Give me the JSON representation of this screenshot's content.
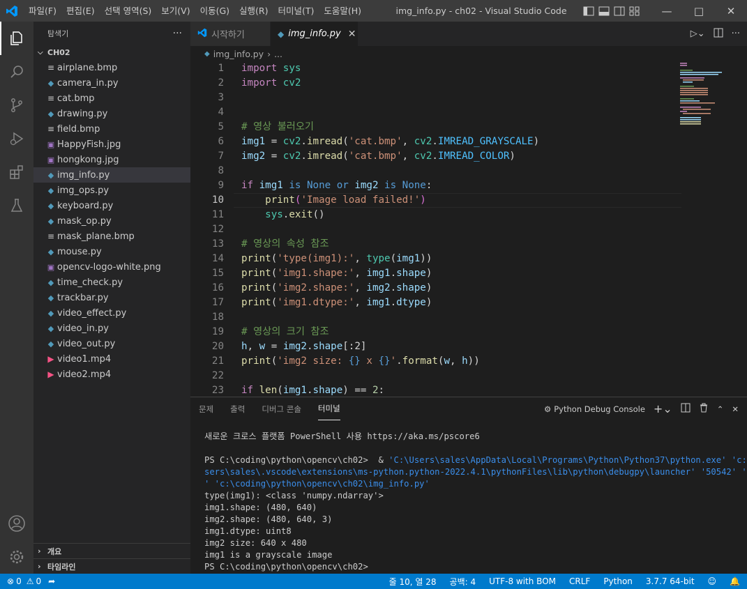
{
  "titlebar": {
    "menu": [
      "파일(F)",
      "편집(E)",
      "선택 영역(S)",
      "보기(V)",
      "이동(G)",
      "실행(R)",
      "터미널(T)",
      "도움말(H)"
    ],
    "title": "img_info.py - ch02 - Visual Studio Code"
  },
  "sidebar": {
    "header": "탐색기",
    "more": "···",
    "folder": "CH02",
    "files": [
      {
        "name": "airplane.bmp",
        "type": "bmp"
      },
      {
        "name": "camera_in.py",
        "type": "py"
      },
      {
        "name": "cat.bmp",
        "type": "bmp"
      },
      {
        "name": "drawing.py",
        "type": "py"
      },
      {
        "name": "field.bmp",
        "type": "bmp"
      },
      {
        "name": "HappyFish.jpg",
        "type": "img"
      },
      {
        "name": "hongkong.jpg",
        "type": "img"
      },
      {
        "name": "img_info.py",
        "type": "py"
      },
      {
        "name": "img_ops.py",
        "type": "py"
      },
      {
        "name": "keyboard.py",
        "type": "py"
      },
      {
        "name": "mask_op.py",
        "type": "py"
      },
      {
        "name": "mask_plane.bmp",
        "type": "bmp"
      },
      {
        "name": "mouse.py",
        "type": "py"
      },
      {
        "name": "opencv-logo-white.png",
        "type": "img"
      },
      {
        "name": "time_check.py",
        "type": "py"
      },
      {
        "name": "trackbar.py",
        "type": "py"
      },
      {
        "name": "video_effect.py",
        "type": "py"
      },
      {
        "name": "video_in.py",
        "type": "py"
      },
      {
        "name": "video_out.py",
        "type": "py"
      },
      {
        "name": "video1.mp4",
        "type": "mp4"
      },
      {
        "name": "video2.mp4",
        "type": "mp4"
      }
    ],
    "outline": "개요",
    "timeline": "타임라인"
  },
  "tabs": [
    {
      "label": "시작하기",
      "active": false
    },
    {
      "label": "img_info.py",
      "active": true
    }
  ],
  "breadcrumb": {
    "file": "img_info.py",
    "rest": "..."
  },
  "code": {
    "cursor_line": 10,
    "lines": [
      {
        "n": "1"
      },
      {
        "n": "2"
      },
      {
        "n": "3"
      },
      {
        "n": "4"
      },
      {
        "n": "5"
      },
      {
        "n": "6"
      },
      {
        "n": "7"
      },
      {
        "n": "8"
      },
      {
        "n": "9"
      },
      {
        "n": "10"
      },
      {
        "n": "11"
      },
      {
        "n": "12"
      },
      {
        "n": "13"
      },
      {
        "n": "14"
      },
      {
        "n": "15"
      },
      {
        "n": "16"
      },
      {
        "n": "17"
      },
      {
        "n": "18"
      },
      {
        "n": "19"
      },
      {
        "n": "20"
      },
      {
        "n": "21"
      },
      {
        "n": "22"
      },
      {
        "n": "23"
      }
    ],
    "text": {
      "l1": [
        "import",
        " sys"
      ],
      "l2": [
        "import",
        " cv2"
      ],
      "l5": "# 영상 불러오기",
      "l6": [
        "img1",
        " = ",
        "cv2",
        ".",
        "imread",
        "(",
        "'cat.bmp'",
        ", ",
        "cv2",
        ".",
        "IMREAD_GRAYSCALE",
        ")"
      ],
      "l7": [
        "img2",
        " = ",
        "cv2",
        ".",
        "imread",
        "(",
        "'cat.bmp'",
        ", ",
        "cv2",
        ".",
        "IMREAD_COLOR",
        ")"
      ],
      "l9": [
        "if",
        " ",
        "img1",
        " is ",
        "None",
        " or ",
        "img2",
        " is ",
        "None",
        ":"
      ],
      "l10": [
        "    ",
        "print",
        "(",
        "'Image load failed!'",
        ")"
      ],
      "l11": [
        "    ",
        "sys",
        ".",
        "exit",
        "()"
      ],
      "l13": "# 영상의 속성 참조",
      "l14": [
        "print",
        "(",
        "'type(img1):'",
        ", ",
        "type",
        "(",
        "img1",
        "))"
      ],
      "l15": [
        "print",
        "(",
        "'img1.shape:'",
        ", ",
        "img1",
        ".",
        "shape",
        ")"
      ],
      "l16": [
        "print",
        "(",
        "'img2.shape:'",
        ", ",
        "img2",
        ".",
        "shape",
        ")"
      ],
      "l17": [
        "print",
        "(",
        "'img1.dtype:'",
        ", ",
        "img1",
        ".",
        "dtype",
        ")"
      ],
      "l19": "# 영상의 크기 참조",
      "l20": [
        "h",
        ", ",
        "w",
        " = ",
        "img2",
        ".",
        "shape",
        "[:2]"
      ],
      "l21": [
        "print",
        "(",
        "'img2 size: ",
        "{}",
        " x ",
        "{}",
        "'",
        ".",
        "format",
        "(",
        "w",
        ", ",
        "h",
        "))"
      ],
      "l23": [
        "if",
        " ",
        "len",
        "(",
        "img1",
        ".",
        "shape",
        ") == ",
        "2",
        ":"
      ]
    }
  },
  "panel": {
    "tabs": [
      "문제",
      "출력",
      "디버그 콘솔",
      "터미널"
    ],
    "active_tab": "터미널",
    "debug_console": "Python Debug Console",
    "terminal": [
      "새로운 크로스 플랫폼 PowerShell 사용 https://aka.ms/pscore6",
      "",
      "PS C:\\coding\\python\\opencv\\ch02>  & ",
      "'C:\\Users\\sales\\AppData\\Local\\Programs\\Python\\Python37\\python.exe' 'c:\\U",
      "sers\\sales\\.vscode\\extensions\\ms-python.python-2022.4.1\\pythonFiles\\lib\\python\\debugpy\\launcher' '50542' '--",
      "' 'c:\\coding\\python\\opencv\\ch02\\img_info.py'",
      "type(img1): <class 'numpy.ndarray'>",
      "img1.shape: (480, 640)",
      "img2.shape: (480, 640, 3)",
      "img1.dtype: uint8",
      "img2 size: 640 x 480",
      "img1 is a grayscale image",
      "PS C:\\coding\\python\\opencv\\ch02>"
    ]
  },
  "statusbar": {
    "errors": "0",
    "warnings": "0",
    "position": "줄 10, 열 28",
    "spaces": "공백: 4",
    "encoding": "UTF-8 with BOM",
    "eol": "CRLF",
    "language": "Python",
    "interpreter": "3.7.7 64-bit"
  },
  "colors": {
    "accent": "#007acc",
    "keyword": "#c586c0",
    "string": "#ce9178",
    "comment": "#6a9955",
    "function": "#dcdcaa",
    "variable": "#9cdcfe",
    "constant": "#4fc1ff"
  }
}
